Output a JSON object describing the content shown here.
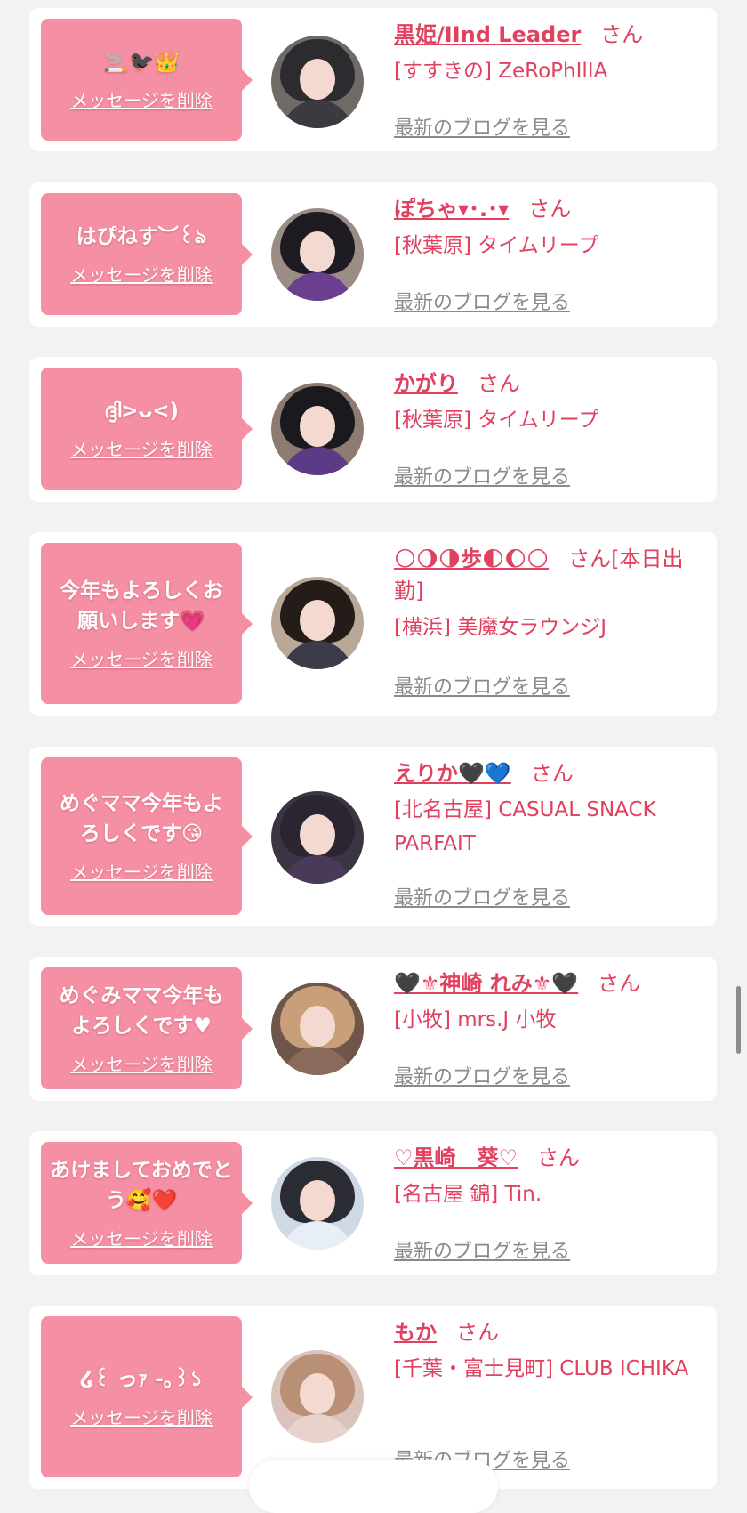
{
  "colors": {
    "page_bg": "#f2f2f2",
    "card_bg": "#ffffff",
    "bubble": "#f58fa3",
    "name_pink": "#e0415f",
    "blog_gray": "#8a8a8a"
  },
  "delete_label": "メッセージを削除",
  "blog_label": "最新のブログを見る",
  "san_label": "さん",
  "messages": [
    {
      "message": "🚬🐦‍⬛👑",
      "name": "黒姫/IInd Leader",
      "store": "[すすきの] ZeRoPhIlIA",
      "avatar_icon": "avatar-dark-hair",
      "avatar_hair": "#2b2b30",
      "avatar_body": "#3a3a40",
      "avatar_bg": "#6f6a66"
    },
    {
      "message": "はぴねす︶꒰ঌ",
      "name": "ぽちゃ▾･.･▾",
      "store": "[秋葉原] タイムリープ",
      "avatar_icon": "avatar-maid",
      "avatar_hair": "#1f1b22",
      "avatar_body": "#6a3f8f",
      "avatar_bg": "#9c8c86"
    },
    {
      "message": "ദ്ദി>ᴗ<)",
      "name": "かがり",
      "store": "[秋葉原] タイムリープ",
      "avatar_icon": "avatar-maid",
      "avatar_hair": "#1a1a1e",
      "avatar_body": "#5b3a86",
      "avatar_bg": "#8d7a70"
    },
    {
      "message": "今年もよろしくお願いします💗",
      "name": "🌕🌖🌗歩🌓🌔🌕",
      "store": "[横浜] 美魔女ラウンジJ",
      "name_extra": "[本日出勤]",
      "avatar_icon": "avatar-kimono",
      "avatar_hair": "#231c18",
      "avatar_body": "#3d3a4a",
      "avatar_bg": "#b9a898"
    },
    {
      "message": "めぐママ今年もよろしくです😘",
      "name": "えりか🖤💙",
      "store": "[北名古屋] CASUAL SNACK PARFAIT",
      "avatar_icon": "avatar-hearts",
      "avatar_hair": "#2a2530",
      "avatar_body": "#4a3a5a",
      "avatar_bg": "#3b3443"
    },
    {
      "message": "めぐみママ今年もよろしくです♥",
      "name": "🖤⚜神崎 れみ⚜🖤",
      "store": "[小牧] mrs.J 小牧",
      "avatar_icon": "avatar-blonde",
      "avatar_hair": "#c99f7a",
      "avatar_body": "#8a6a5a",
      "avatar_bg": "#6e564a"
    },
    {
      "message": "あけましておめでとう🥰❤️",
      "name": "♡黒崎　葵♡",
      "store": "[名古屋 錦] Tin.",
      "avatar_icon": "avatar-snow",
      "avatar_hair": "#2b2b33",
      "avatar_body": "#e8eef5",
      "avatar_bg": "#cfd9e6"
    },
    {
      "message": "໒꒰ っｧ -｡꒱১",
      "name": "もか",
      "store": "[千葉・富士見町] CLUB ICHIKA",
      "avatar_icon": "avatar-light-hair",
      "avatar_hair": "#b99076",
      "avatar_body": "#e7d3cc",
      "avatar_bg": "#d9c3bb"
    }
  ]
}
